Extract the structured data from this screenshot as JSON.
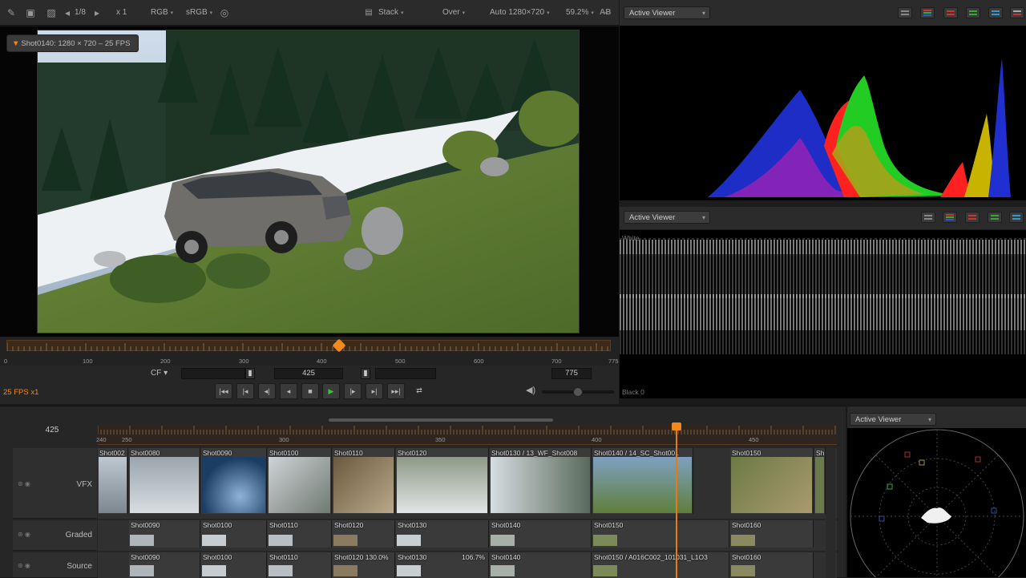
{
  "toolbar": {
    "page": "1/8",
    "zoom_factor": "x 1",
    "channel": "RGB",
    "colorspace": "sRGB",
    "layer_mode": "Stack",
    "composite": "Over",
    "resolution": "Auto 1280×720",
    "zoom_percent": "59.2%",
    "icons": [
      "brush-icon",
      "save-icon",
      "checker-icon",
      "prev-icon",
      "next-icon",
      "target-icon",
      "ab-icon"
    ]
  },
  "viewer": {
    "shot_label": "Shot0140: 1280 × 720 – 25 FPS"
  },
  "scrubber": {
    "ticks": [
      "0",
      "100",
      "200",
      "300",
      "400",
      "500",
      "600",
      "700",
      "775"
    ],
    "position_fraction": 0.55
  },
  "transport": {
    "cf_label": "CF",
    "in_value": "",
    "current_frame": "425",
    "end_frame": "775",
    "fps_label": "25 FPS x1",
    "volume_fraction": 0.5
  },
  "scopes": {
    "top_dropdown": "Active Viewer",
    "middle_dropdown": "Active Viewer",
    "white_label": "White",
    "black_label": "Black 0",
    "vector_dropdown": "Active Viewer",
    "colors": {
      "red": "#ff2020",
      "green": "#22cc22",
      "blue": "#1f2fd0",
      "yellow": "#c8b400",
      "accent": "#f08a1c"
    }
  },
  "timeline": {
    "current_frame": "425",
    "ruler_ticks": [
      "240",
      "250",
      "300",
      "350",
      "400",
      "450"
    ],
    "tracks": [
      {
        "name": "VFX",
        "clips": [
          "Shot002",
          "Shot0080",
          "Shot0090",
          "Shot0100",
          "Shot0110",
          "Shot0120",
          "Shot0130 / 13_WF_Shot008",
          "Shot0140 / 14_SC_Shot001",
          "Shot0150",
          "Sh"
        ]
      },
      {
        "name": "Graded",
        "clips": [
          "Shot0090",
          "Shot0100",
          "Shot0110",
          "Shot0120",
          "Shot0130",
          "Shot0140",
          "Shot0150",
          "Shot0160"
        ]
      },
      {
        "name": "Source",
        "clips": [
          "Shot0090",
          "Shot0100",
          "Shot0110",
          "Shot0120 130.0%",
          "Shot0130",
          "106.7%",
          "Shot0140",
          "Shot0150 / A016C002_101031_L1O3",
          "Shot0160"
        ]
      }
    ]
  }
}
